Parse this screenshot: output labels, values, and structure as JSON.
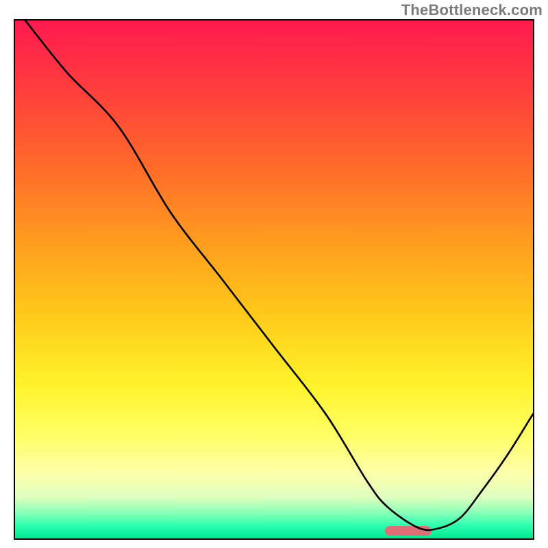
{
  "watermark": "TheBottleneck.com",
  "chart_data": {
    "type": "line",
    "title": "",
    "xlabel": "",
    "ylabel": "",
    "xlim": [
      0,
      100
    ],
    "ylim": [
      0,
      100
    ],
    "grid": false,
    "legend": "none",
    "series": [
      {
        "name": "curve",
        "x": [
          2,
          10,
          20,
          30,
          40,
          50,
          60,
          68,
          72,
          78,
          82,
          86,
          90,
          95,
          100
        ],
        "y": [
          100,
          90,
          79.5,
          63,
          50,
          37,
          24,
          11,
          6,
          2,
          2,
          4,
          9,
          16,
          24
        ]
      }
    ],
    "marker": {
      "x_start": 71,
      "x_end": 80,
      "y": 2
    },
    "background_gradient": {
      "stops": [
        {
          "pos": 0,
          "color": "#ff1a4f"
        },
        {
          "pos": 12,
          "color": "#ff3a3e"
        },
        {
          "pos": 28,
          "color": "#ff6a2a"
        },
        {
          "pos": 42,
          "color": "#ff9a1f"
        },
        {
          "pos": 56,
          "color": "#ffc71a"
        },
        {
          "pos": 70,
          "color": "#fff22a"
        },
        {
          "pos": 80,
          "color": "#ffff66"
        },
        {
          "pos": 87,
          "color": "#ffffa8"
        },
        {
          "pos": 92,
          "color": "#dfffc0"
        },
        {
          "pos": 95,
          "color": "#8affb8"
        },
        {
          "pos": 97.5,
          "color": "#2cffb0"
        },
        {
          "pos": 100,
          "color": "#00e890"
        }
      ]
    }
  }
}
